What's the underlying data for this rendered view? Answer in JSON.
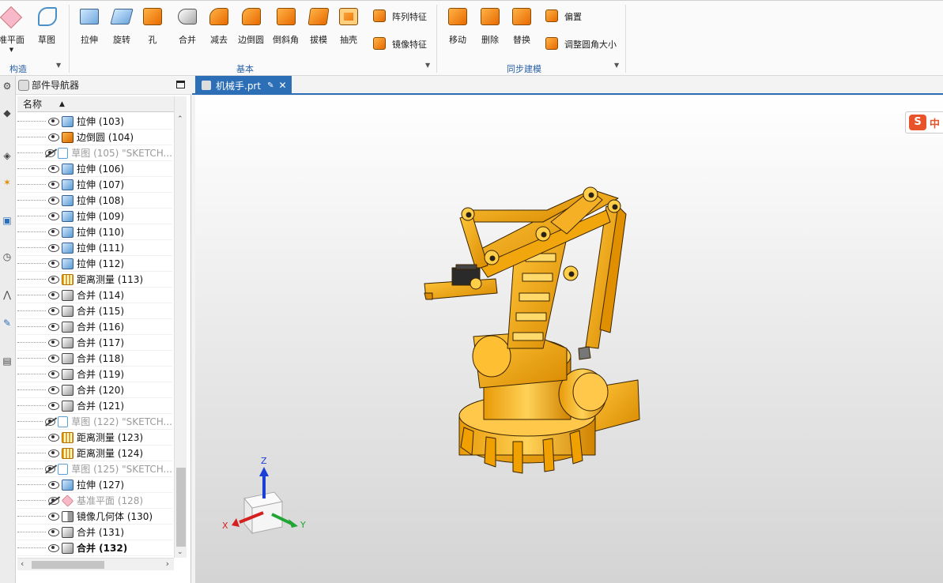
{
  "ribbon": {
    "construct": {
      "datum_plane": "准平面",
      "sketch": "草图",
      "group": "构造"
    },
    "basic": {
      "extrude": "拉伸",
      "revolve": "旋转",
      "hole": "孔",
      "unite": "合并",
      "subtract": "减去",
      "edge_blend": "边倒圆",
      "chamfer": "倒斜角",
      "draft": "拔模",
      "shell": "抽壳",
      "pattern_feature": "阵列特征",
      "mirror_feature": "镜像特征",
      "group": "基本"
    },
    "sync": {
      "move": "移动",
      "delete": "删除",
      "replace": "替换",
      "offset": "偏置",
      "resize_blend": "调整圆角大小",
      "group": "同步建模"
    }
  },
  "navigator": {
    "title": "部件导航器",
    "column_name": "名称",
    "items": [
      {
        "label": "拉伸 (103)",
        "type": "extrude",
        "visible": true
      },
      {
        "label": "边倒圆 (104)",
        "type": "blend",
        "visible": true
      },
      {
        "label": "草图 (105) \"SKETCH...",
        "type": "sketch",
        "visible": false
      },
      {
        "label": "拉伸 (106)",
        "type": "extrude",
        "visible": true
      },
      {
        "label": "拉伸 (107)",
        "type": "extrude",
        "visible": true
      },
      {
        "label": "拉伸 (108)",
        "type": "extrude",
        "visible": true
      },
      {
        "label": "拉伸 (109)",
        "type": "extrude",
        "visible": true
      },
      {
        "label": "拉伸 (110)",
        "type": "extrude",
        "visible": true
      },
      {
        "label": "拉伸 (111)",
        "type": "extrude",
        "visible": true
      },
      {
        "label": "拉伸 (112)",
        "type": "extrude",
        "visible": true
      },
      {
        "label": "距离测量 (113)",
        "type": "measure",
        "visible": true
      },
      {
        "label": "合并 (114)",
        "type": "unite",
        "visible": true
      },
      {
        "label": "合并 (115)",
        "type": "unite",
        "visible": true
      },
      {
        "label": "合并 (116)",
        "type": "unite",
        "visible": true
      },
      {
        "label": "合并 (117)",
        "type": "unite",
        "visible": true
      },
      {
        "label": "合并 (118)",
        "type": "unite",
        "visible": true
      },
      {
        "label": "合并 (119)",
        "type": "unite",
        "visible": true
      },
      {
        "label": "合并 (120)",
        "type": "unite",
        "visible": true
      },
      {
        "label": "合并 (121)",
        "type": "unite",
        "visible": true
      },
      {
        "label": "草图 (122) \"SKETCH...",
        "type": "sketch",
        "visible": false
      },
      {
        "label": "距离测量 (123)",
        "type": "measure",
        "visible": true
      },
      {
        "label": "距离测量 (124)",
        "type": "measure",
        "visible": true
      },
      {
        "label": "草图 (125) \"SKETCH...",
        "type": "sketch",
        "visible": false
      },
      {
        "label": "拉伸 (127)",
        "type": "extrude",
        "visible": true
      },
      {
        "label": "基准平面 (128)",
        "type": "plane",
        "visible": false
      },
      {
        "label": "镜像几何体 (130)",
        "type": "mirror",
        "visible": true
      },
      {
        "label": "合并 (131)",
        "type": "unite",
        "visible": true
      },
      {
        "label": "合并 (132)",
        "type": "unite",
        "visible": true,
        "bold": true
      }
    ]
  },
  "tab": {
    "label": "机械手.prt"
  },
  "triad": {
    "x": "X",
    "y": "Y",
    "z": "Z"
  },
  "ime": {
    "letter": "S",
    "text": "中"
  },
  "colors": {
    "model": "#f2a60e",
    "accent": "#2d6fb6"
  }
}
